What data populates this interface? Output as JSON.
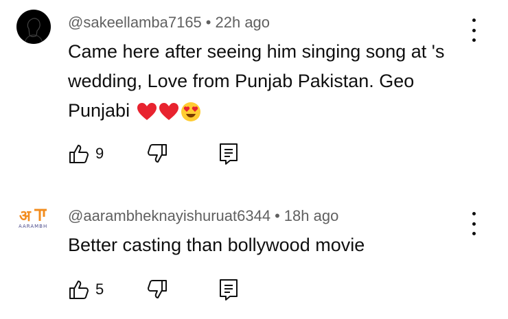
{
  "comments": [
    {
      "author": "@sakeellamba7165",
      "separator": "•",
      "time": "22h ago",
      "text": "Came here after seeing him singing song at 's wedding, Love from Punjab Pakistan. Geo Punjabi",
      "emojis": [
        "heart-emoji",
        "heart-emoji",
        "heart-eyes-emoji"
      ],
      "likes": "9",
      "avatar": "silhouette-avatar"
    },
    {
      "author": "@aarambheknayishuruat6344",
      "separator": "•",
      "time": "18h ago",
      "text": "Better casting than bollywood movie",
      "emojis": [],
      "likes": "5",
      "avatar": "aarambh-logo-avatar",
      "avatar_text": "AARAMBH"
    }
  ],
  "colors": {
    "meta_text": "#606060",
    "body_text": "#0f0f0f",
    "logo_orange": "#f28c1e"
  }
}
